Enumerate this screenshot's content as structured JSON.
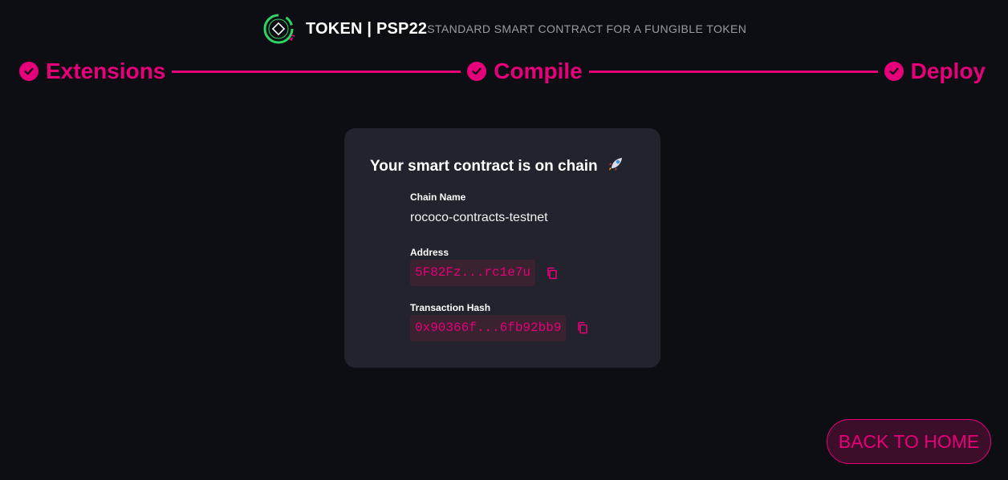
{
  "header": {
    "brand": "TOKEN | PSP22",
    "subtitle": "STANDARD SMART CONTRACT FOR A FUNGIBLE TOKEN",
    "logo_icon": "contract-wizard-logo-icon"
  },
  "stepper": {
    "steps": [
      {
        "label": "Extensions",
        "status": "completed",
        "icon": "check-circle-icon"
      },
      {
        "label": "Compile",
        "status": "completed",
        "icon": "check-circle-icon"
      },
      {
        "label": "Deploy",
        "status": "completed",
        "icon": "check-circle-icon"
      }
    ]
  },
  "card": {
    "title": "Your smart contract is on chain",
    "title_icon": "rocket-icon",
    "chain_name_label": "Chain Name",
    "chain_name_value": "rococo-contracts-testnet",
    "address_label": "Address",
    "address_value": "5F82Fz...rc1e7u",
    "tx_hash_label": "Transaction Hash",
    "tx_hash_value": "0x90366f...6fb92bb9",
    "copy_icon": "copy-icon"
  },
  "actions": {
    "back_label": "BACK TO HOME"
  },
  "colors": {
    "accent": "#e6007a",
    "background": "#0d0e13",
    "card": "#22232c",
    "logo_green": "#2bd664"
  }
}
